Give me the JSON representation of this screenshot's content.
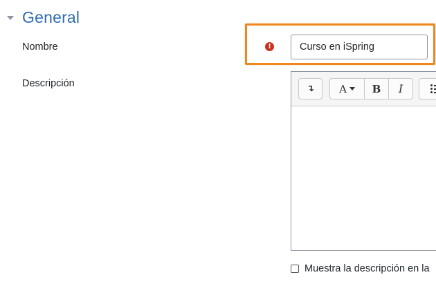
{
  "section": {
    "title": "General",
    "toggle_icon": "caret-down-icon"
  },
  "fields": {
    "name": {
      "label": "Nombre",
      "value": "Curso en iSpring",
      "required_icon": "exclamation-circle-icon",
      "required_icon_glyph": "!"
    },
    "description": {
      "label": "Descripción"
    }
  },
  "editor": {
    "toolbar": {
      "expand_glyph": "↴",
      "font_glyph": "A",
      "bold_glyph": "B",
      "italic_glyph": "I"
    },
    "content": ""
  },
  "show_description": {
    "label": "Muestra la descripción en la",
    "checked": false
  },
  "colors": {
    "accent": "#2f6cae",
    "highlight": "#f0861e",
    "error": "#ca3120"
  }
}
